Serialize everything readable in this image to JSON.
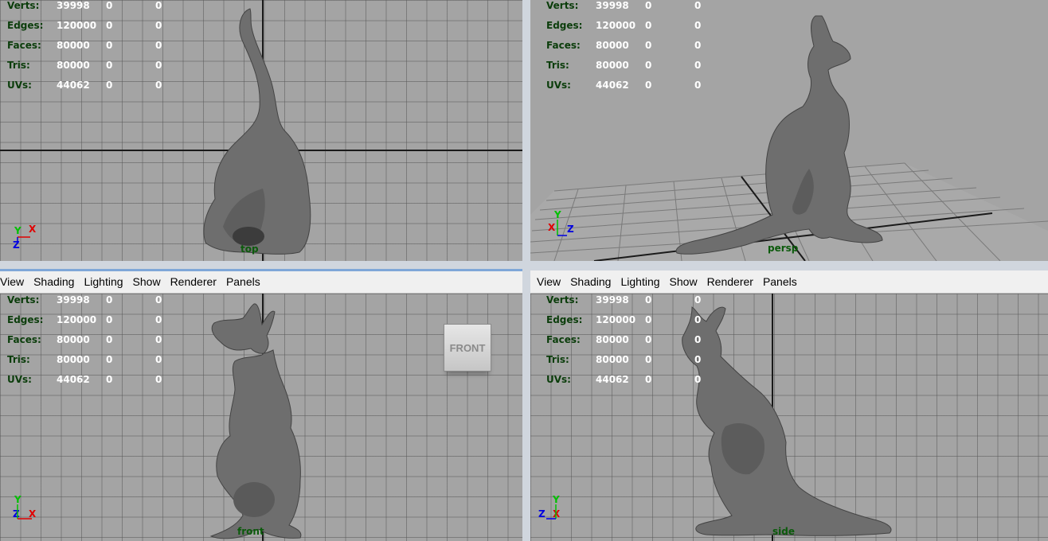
{
  "menu": [
    "View",
    "Shading",
    "Lighting",
    "Show",
    "Renderer",
    "Panels"
  ],
  "stats_rows": [
    {
      "label": "Verts:",
      "v1": "39998",
      "v2": "0",
      "v3": "0"
    },
    {
      "label": "Edges:",
      "v1": "120000",
      "v2": "0",
      "v3": "0"
    },
    {
      "label": "Faces:",
      "v1": "80000",
      "v2": "0",
      "v3": "0"
    },
    {
      "label": "Tris:",
      "v1": "80000",
      "v2": "0",
      "v3": "0"
    },
    {
      "label": "UVs:",
      "v1": "44062",
      "v2": "0",
      "v3": "0"
    }
  ],
  "viewports": {
    "top": {
      "label": "top"
    },
    "persp": {
      "label": "persp"
    },
    "front": {
      "label": "front",
      "viewcube": "FRONT"
    },
    "side": {
      "label": "side"
    }
  },
  "colors": {
    "viewport_bg": "#a4a4a4",
    "model": "#6e6e6e",
    "axis_x": "#e00000",
    "axis_y": "#00c000",
    "axis_z": "#0000e0"
  }
}
